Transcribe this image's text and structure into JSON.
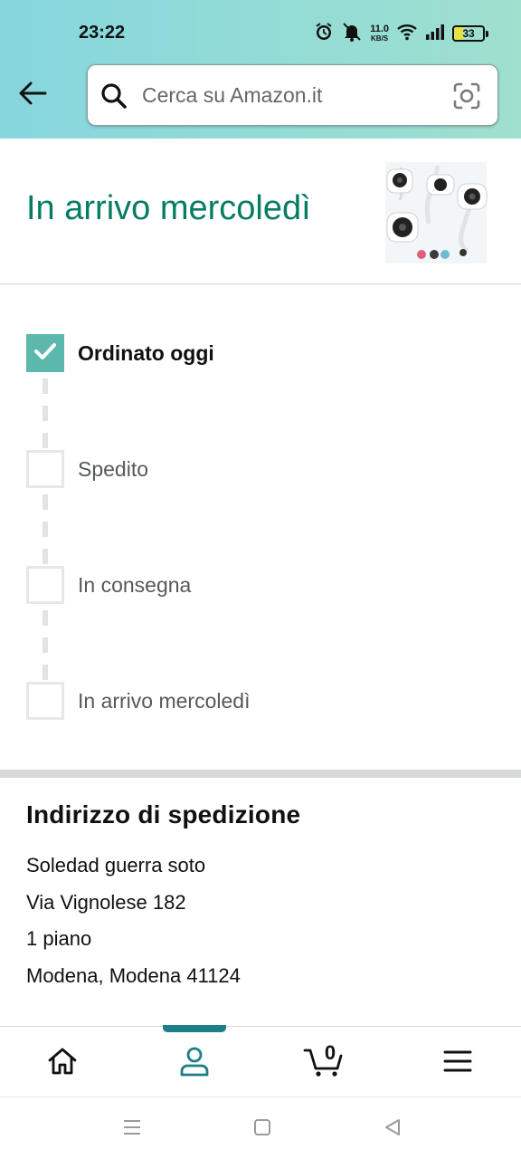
{
  "status_bar": {
    "time": "23:22",
    "net_speed_value": "11.0",
    "net_speed_unit": "KB/S",
    "battery_level": "33",
    "icons": [
      "alarm-icon",
      "mute-icon",
      "wifi-icon",
      "signal-icon",
      "battery-icon"
    ]
  },
  "header": {
    "search_placeholder": "Cerca su Amazon.it",
    "icons": [
      "back-arrow-icon",
      "search-icon",
      "camera-scan-icon"
    ]
  },
  "arrival": {
    "title": "In arrivo mercoledì",
    "product_image": "baby-monitor-cameras"
  },
  "tracker": {
    "steps": [
      {
        "label": "Ordinato oggi",
        "completed": true
      },
      {
        "label": "Spedito",
        "completed": false
      },
      {
        "label": "In consegna",
        "completed": false
      },
      {
        "label": "In arrivo mercoledì",
        "completed": false
      }
    ]
  },
  "address": {
    "title": "Indirizzo di spedizione",
    "lines": [
      "Soledad guerra soto",
      "Via Vignolese 182",
      "1 piano",
      "Modena, Modena 41124"
    ]
  },
  "bottom_nav": {
    "items": [
      "home-icon",
      "account-icon",
      "cart-icon",
      "menu-icon"
    ],
    "active": "account-icon",
    "cart_count": "0"
  },
  "colors": {
    "accent_green": "#067d62",
    "check_teal": "#5cb8ad",
    "nav_indicator": "#1b7e88",
    "header_gradient_start": "#86d6de",
    "header_gradient_end": "#9fe0cf"
  }
}
